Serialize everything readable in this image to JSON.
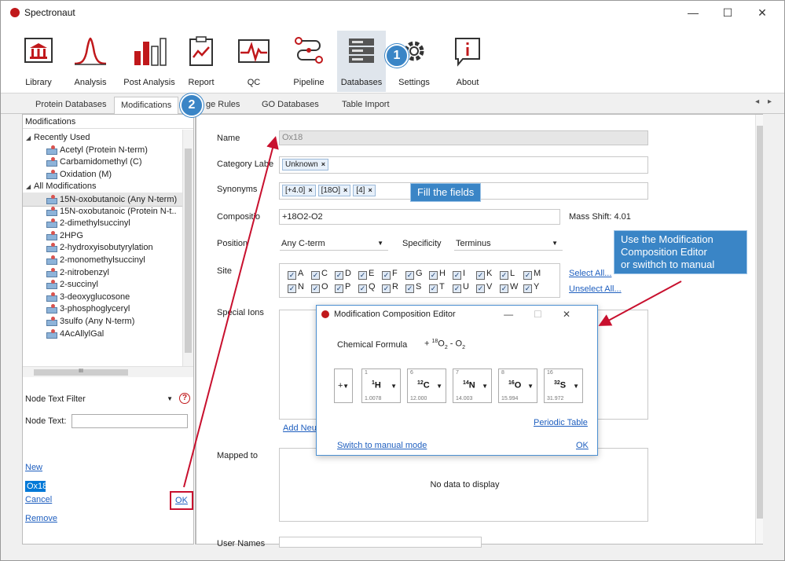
{
  "window": {
    "title": "Spectronaut",
    "controls": {
      "minimize": "—",
      "maximize": "☐",
      "close": "✕"
    }
  },
  "ribbon": [
    {
      "label": "Library",
      "icon": "library-icon"
    },
    {
      "label": "Analysis",
      "icon": "analysis-icon"
    },
    {
      "label": "Post Analysis",
      "icon": "post-analysis-icon"
    },
    {
      "label": "Report",
      "icon": "report-icon"
    },
    {
      "label": "QC",
      "icon": "qc-icon"
    },
    {
      "label": "Pipeline",
      "icon": "pipeline-icon"
    },
    {
      "label": "Databases",
      "icon": "databases-icon",
      "active": true
    },
    {
      "label": "Settings",
      "icon": "gear-icon"
    },
    {
      "label": "About",
      "icon": "about-icon"
    }
  ],
  "tabs": {
    "items": [
      "Protein Databases",
      "Modifications",
      "ge Rules",
      "GO Databases",
      "Table Import"
    ],
    "active": "Modifications",
    "scroll": "◂ ▸"
  },
  "left": {
    "header": "Modifications",
    "tree": [
      {
        "text": "Recently Used",
        "level": 0,
        "toggle": "◢"
      },
      {
        "text": "Acetyl (Protein N-term)",
        "level": 1
      },
      {
        "text": "Carbamidomethyl (C)",
        "level": 1
      },
      {
        "text": "Oxidation (M)",
        "level": 1
      },
      {
        "text": "All Modifications",
        "level": 0,
        "toggle": "◢"
      },
      {
        "text": "15N-oxobutanoic (Any N-term)",
        "level": 1,
        "selected": true
      },
      {
        "text": "15N-oxobutanoic (Protein N-t..",
        "level": 1
      },
      {
        "text": "2-dimethylsuccinyl",
        "level": 1
      },
      {
        "text": "2HPG",
        "level": 1
      },
      {
        "text": "2-hydroxyisobutyrylation",
        "level": 1
      },
      {
        "text": "2-monomethylsuccinyl",
        "level": 1
      },
      {
        "text": "2-nitrobenzyl",
        "level": 1
      },
      {
        "text": "2-succinyl",
        "level": 1
      },
      {
        "text": "3-deoxyglucosone",
        "level": 1
      },
      {
        "text": "3-phosphoglyceryl",
        "level": 1
      },
      {
        "text": "3sulfo (Any N-term)",
        "level": 1
      },
      {
        "text": "4AcAllylGal",
        "level": 1
      }
    ],
    "hscroll_grip": "III",
    "filter_label": "Node Text Filter",
    "help": "?",
    "node_text_label": "Node Text:",
    "new": "New",
    "selected_name": "Ox18",
    "cancel": "Cancel",
    "ok": "OK",
    "remove": "Remove"
  },
  "form": {
    "name_label": "Name",
    "name_value": "Ox18",
    "category_label": "Category Labe",
    "category_tokens": [
      "Unknown"
    ],
    "synonyms_label": "Synonyms",
    "synonym_tokens": [
      "[+4.0]",
      "[18O]",
      "[4]"
    ],
    "composition_label": "Compositio",
    "composition_value": "+18O2-O2",
    "mass_shift": "Mass Shift: 4.01",
    "position_label": "Position",
    "position_value": "Any C-term",
    "specificity_label": "Specificity",
    "specificity_value": "Terminus",
    "site_label": "Site",
    "sites_row1": [
      "A",
      "C",
      "D",
      "E",
      "F",
      "G",
      "H",
      "I",
      "K",
      "L",
      "M"
    ],
    "sites_row2": [
      "N",
      "O",
      "P",
      "Q",
      "R",
      "S",
      "T",
      "U",
      "V",
      "W",
      "Y"
    ],
    "select_all": "Select All...",
    "unselect_all": "Unselect All...",
    "special_ions_label": "Special Ions",
    "add_neutral": "Add Neut",
    "mapped_label": "Mapped to",
    "no_data": "No data to display",
    "user_names_label": "User Names"
  },
  "dialog": {
    "title": "Modification Composition Editor",
    "formula_label": "Chemical Formula",
    "formula_prefix": "+ ",
    "formula_sup1": "18",
    "formula_o1": "O",
    "formula_sub1": "2",
    "formula_mid": " - O",
    "formula_sub2": "2",
    "sign": "+",
    "elements": [
      {
        "num": "1",
        "iso": "1",
        "sym": "H",
        "mass": "1.0078"
      },
      {
        "num": "6",
        "iso": "12",
        "sym": "C",
        "mass": "12.000"
      },
      {
        "num": "7",
        "iso": "14",
        "sym": "N",
        "mass": "14.003"
      },
      {
        "num": "8",
        "iso": "16",
        "sym": "O",
        "mass": "15.994"
      },
      {
        "num": "16",
        "iso": "32",
        "sym": "S",
        "mass": "31.972"
      }
    ],
    "periodic_table": "Periodic Table",
    "switch_manual": "Switch to manual mode",
    "ok": "OK"
  },
  "callouts": {
    "badge1": "1",
    "badge2": "2",
    "fill": "Fill the fields",
    "editor_line1": "Use the Modification",
    "editor_line2": "Composition Editor",
    "editor_line3": "or swithch to manual"
  },
  "colors": {
    "callout": "#3a85c6",
    "arrow": "#c8102e",
    "brand": "#c0181b"
  }
}
